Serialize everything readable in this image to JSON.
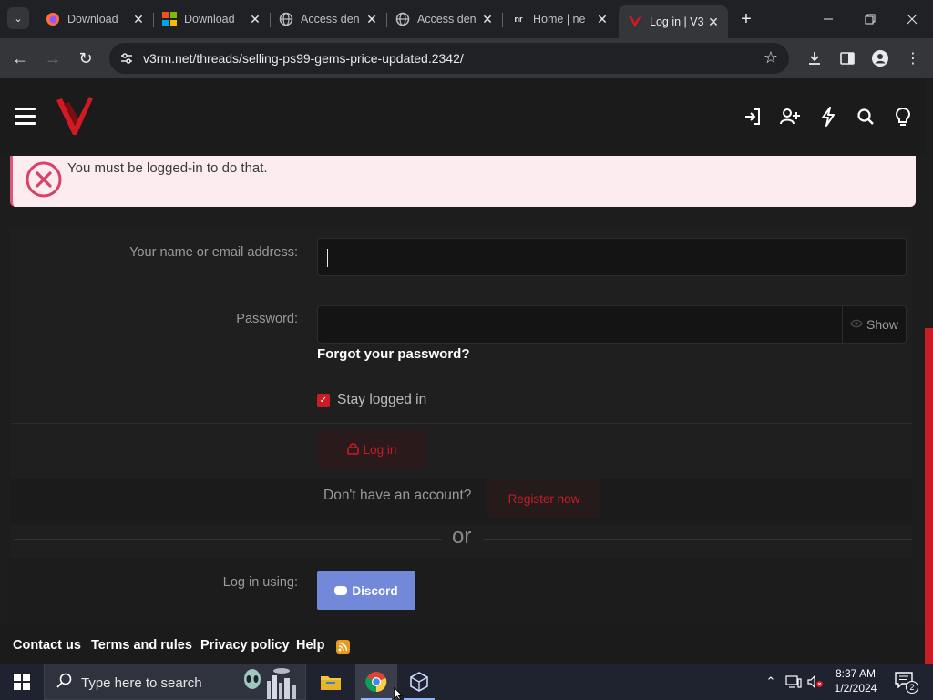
{
  "browser": {
    "tabs": [
      {
        "title": "Download",
        "icon": "firefox-icon",
        "active": false
      },
      {
        "title": "Download",
        "icon": "microsoft-icon",
        "active": false
      },
      {
        "title": "Access den",
        "icon": "globe-icon",
        "active": false
      },
      {
        "title": "Access den",
        "icon": "globe-icon",
        "active": false
      },
      {
        "title": "Home | ne",
        "icon": "nr-icon",
        "icon_text": "nr",
        "active": false
      },
      {
        "title": "Log in | V3",
        "icon": "v3rm-icon",
        "active": true
      }
    ],
    "url": "v3rm.net/threads/selling-ps99-gems-price-updated.2342/",
    "window_controls": [
      "minimize",
      "restore",
      "close"
    ]
  },
  "site": {
    "header_icons": [
      "login-icon",
      "register-icon",
      "whats-new-icon",
      "search-icon",
      "theme-icon"
    ],
    "alert": {
      "message": "You must be logged-in to do that."
    },
    "form": {
      "name_label": "Your name or email address:",
      "name_value": "",
      "password_label": "Password:",
      "password_value": "",
      "show_label": "Show",
      "forgot_link": "Forgot your password?",
      "stay_logged_in_label": "Stay logged in",
      "stay_logged_in_checked": true,
      "login_button": "Log in",
      "no_account_text": "Don't have an account?",
      "register_button": "Register now",
      "or_text": "or",
      "log_in_using_label": "Log in using:",
      "discord_button": "Discord"
    },
    "footer": {
      "links": [
        "Contact us",
        "Terms and rules",
        "Privacy policy",
        "Help"
      ]
    },
    "colors": {
      "accent": "#c81d25",
      "discord": "#7289da",
      "alert_bg": "#fdecef"
    }
  },
  "taskbar": {
    "search_placeholder": "Type here to search",
    "apps": [
      "file-explorer-icon",
      "chrome-icon",
      "virtualbox-icon"
    ],
    "time": "8:37 AM",
    "date": "1/2/2024",
    "notification_count": "2"
  }
}
